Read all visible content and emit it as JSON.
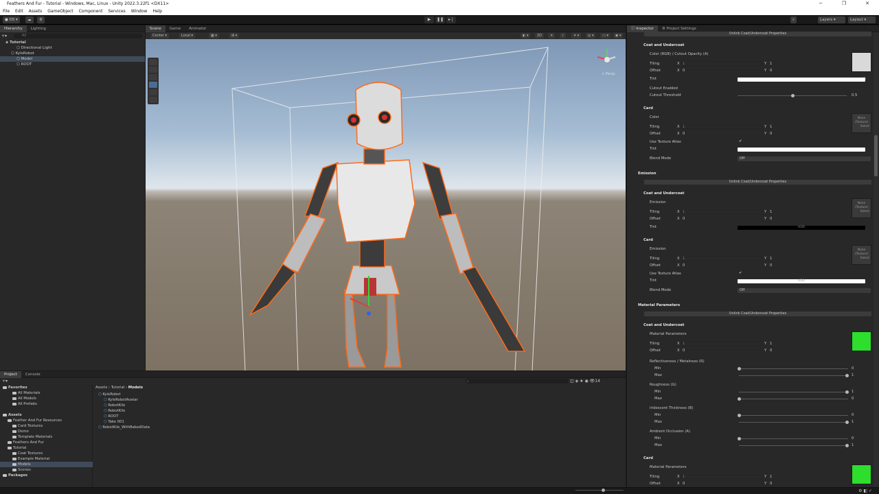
{
  "window": {
    "title": "Feathers And Fur - Tutorial - Windows, Mac, Linux - Unity 2022.3.22f1 <DX11>"
  },
  "menu": [
    "File",
    "Edit",
    "Assets",
    "GameObject",
    "Component",
    "Services",
    "Window",
    "Help"
  ],
  "toolbar": {
    "account": "DS",
    "layers": "Layers",
    "layout": "Layout"
  },
  "hierarchy": {
    "tabs": [
      "Hierarchy",
      "Lighting"
    ],
    "search_placeholder": "All",
    "rows": [
      {
        "label": "Tutorial",
        "indent": 0,
        "selected": false
      },
      {
        "label": "Directional Light",
        "indent": 2,
        "selected": false
      },
      {
        "label": "KyleRobot",
        "indent": 1,
        "selected": false
      },
      {
        "label": "Model",
        "indent": 2,
        "selected": true
      },
      {
        "label": "ROOT",
        "indent": 2,
        "selected": false
      }
    ]
  },
  "scene": {
    "tabs": [
      "Scene",
      "Game",
      "Animator"
    ],
    "pivot": "Center",
    "space": "Local",
    "mode_2d": "2D",
    "gizmo_label": "< Persp"
  },
  "inspector": {
    "tabs": [
      "Inspector",
      "Project Settings"
    ],
    "unlink_label": "Unlink Coat/Undercoat Properties",
    "sections": {
      "coat_undercoat": "Coat and Undercoat",
      "card": "Card",
      "emission": "Emission",
      "material_parameters": "Material Parameters"
    },
    "labels": {
      "color_opacity": "Color (RGB) / Cutout Opacity (A)",
      "tiling": "Tiling",
      "offset": "Offset",
      "x": "X",
      "y": "Y",
      "tint": "Tint",
      "cutout_enabled": "Cutout Enabled",
      "cutout_threshold": "Cutout Threshold",
      "color": "Color",
      "use_texture_atlas": "Use Texture Atlas",
      "blend_mode": "Blend Mode",
      "emission": "Emission",
      "material_parameters": "Material Parameters",
      "reflectiveness": "Reflectiveness / Metalness (R)",
      "roughness": "Roughness (G)",
      "iridescent": "Iridescent Thickness (B)",
      "ambient_occlusion": "Ambient Occlusion (A)",
      "min": "Min",
      "max": "Max",
      "none_texture": "None (Texture)",
      "select": "Select",
      "hdr": "HDR",
      "check": "✔"
    },
    "values": {
      "one": "1",
      "zero": "0",
      "cutout_threshold": "0.5",
      "blend_off": "Off"
    }
  },
  "project": {
    "tabs": [
      "Project",
      "Console"
    ],
    "breadcrumb": [
      "Assets",
      "Tutorial",
      "Models"
    ],
    "item_count": "14",
    "tree": [
      {
        "label": "Favorites",
        "indent": 0,
        "bold": true
      },
      {
        "label": "All Materials",
        "indent": 2,
        "bold": false
      },
      {
        "label": "All Models",
        "indent": 2,
        "bold": false
      },
      {
        "label": "All Prefabs",
        "indent": 2,
        "bold": false
      },
      {
        "label": "",
        "indent": 0,
        "bold": false
      },
      {
        "label": "Assets",
        "indent": 0,
        "bold": true
      },
      {
        "label": "Feather And Fur Resources",
        "indent": 1,
        "bold": false
      },
      {
        "label": "Card Textures",
        "indent": 2,
        "bold": false
      },
      {
        "label": "Demo",
        "indent": 2,
        "bold": false
      },
      {
        "label": "Template Materials",
        "indent": 2,
        "bold": false
      },
      {
        "label": "Feathers And Fur",
        "indent": 1,
        "bold": false
      },
      {
        "label": "Tutorial",
        "indent": 1,
        "bold": false
      },
      {
        "label": "Coat Textures",
        "indent": 2,
        "bold": false
      },
      {
        "label": "Example Material",
        "indent": 2,
        "bold": false
      },
      {
        "label": "Models",
        "indent": 2,
        "bold": false,
        "selected": true
      },
      {
        "label": "Scenes",
        "indent": 2,
        "bold": false
      },
      {
        "label": "Packages",
        "indent": 0,
        "bold": true
      }
    ],
    "files": [
      {
        "label": "KyleRobot",
        "indent": 0
      },
      {
        "label": "KyleRobotAvatar",
        "indent": 1
      },
      {
        "label": "RobotKile",
        "indent": 1
      },
      {
        "label": "RobotKile",
        "indent": 1
      },
      {
        "label": "ROOT",
        "indent": 1
      },
      {
        "label": "Take 001",
        "indent": 1
      },
      {
        "label": "RobotKile_WithBakedData",
        "indent": 0
      }
    ]
  },
  "colors": {
    "accent": "#3d6fb5",
    "green_swatch": "#2dde2d",
    "selection_outline": "#ff6a1a"
  }
}
